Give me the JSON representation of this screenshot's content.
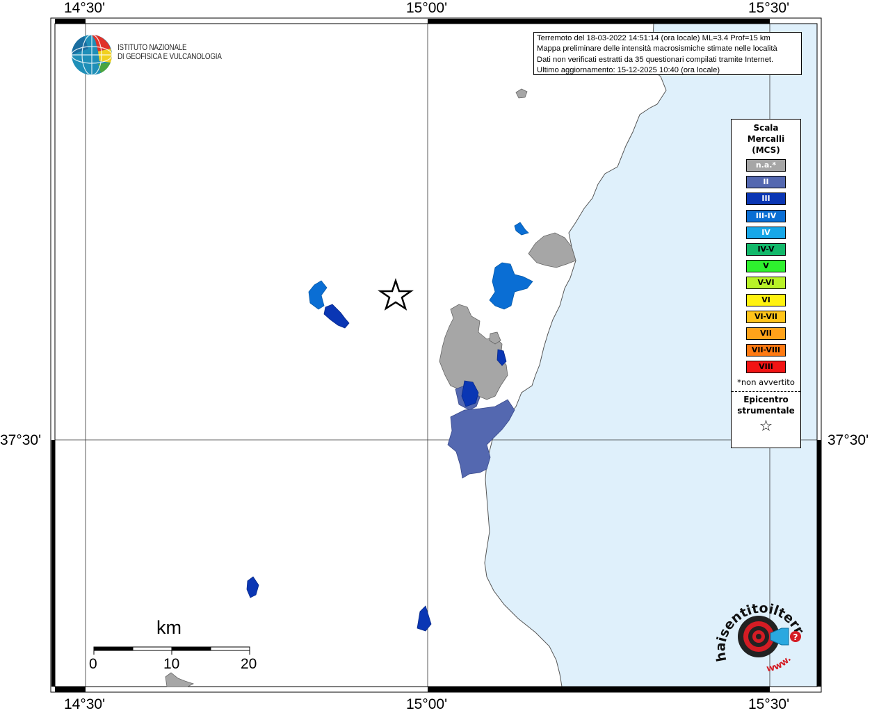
{
  "header": {
    "info_lines": [
      "Terremoto del 18-03-2022 14:51:14 (ora locale) ML=3.4 Prof=15 km",
      "Mappa preliminare delle intensità macrosismiche stimate nelle località",
      "Dati non verificati estratti da 35 questionari compilati tramite Internet.",
      "Ultimo aggiornamento: 15-12-2025 10:40 (ora locale)"
    ]
  },
  "institution": {
    "line1": "ISTITUTO NAZIONALE",
    "line2": "DI GEOFISICA E VULCANOLOGIA"
  },
  "axes": {
    "top_labels": [
      "14°30'",
      "15°00'",
      "15°30'"
    ],
    "bottom_labels": [
      "14°30'",
      "15°00'",
      "15°30'"
    ],
    "left_label": "37°30'",
    "right_label": "37°30'"
  },
  "legend": {
    "title": [
      "Scala",
      "Mercalli",
      "(MCS)"
    ],
    "classes": [
      {
        "label": "n.a.*",
        "color": "#a6a6a6",
        "text_color": "#ffffff"
      },
      {
        "label": "II",
        "color": "#5468b0",
        "text_color": "#ffffff"
      },
      {
        "label": "III",
        "color": "#0a36b4",
        "text_color": "#ffffff"
      },
      {
        "label": "III-IV",
        "color": "#0a6ed4",
        "text_color": "#ffffff"
      },
      {
        "label": "IV",
        "color": "#17a7e8",
        "text_color": "#ffffff"
      },
      {
        "label": "IV-V",
        "color": "#12b86a",
        "text_color": "#000000"
      },
      {
        "label": "V",
        "color": "#2ef02e",
        "text_color": "#000000"
      },
      {
        "label": "V-VI",
        "color": "#b8f227",
        "text_color": "#000000"
      },
      {
        "label": "VI",
        "color": "#fff20f",
        "text_color": "#000000"
      },
      {
        "label": "VI-VII",
        "color": "#ffc41a",
        "text_color": "#000000"
      },
      {
        "label": "VII",
        "color": "#ffa21a",
        "text_color": "#000000"
      },
      {
        "label": "VII-VIII",
        "color": "#ff7a12",
        "text_color": "#000000"
      },
      {
        "label": "VIII",
        "color": "#f21414",
        "text_color": "#000000"
      }
    ],
    "note": "*non avvertito",
    "epicenter_title": [
      "Epicentro",
      "strumentale"
    ],
    "epicenter_symbol": "☆"
  },
  "scalebar": {
    "unit": "km",
    "ticks": [
      "0",
      "10",
      "20"
    ]
  },
  "map_layers": {
    "land_color": "#ffffff",
    "sea_color": "#dff0fb",
    "coast_color": "#555555"
  },
  "footer_logo": {
    "text": "haisentitoilterremoto.it",
    "www": "www."
  }
}
